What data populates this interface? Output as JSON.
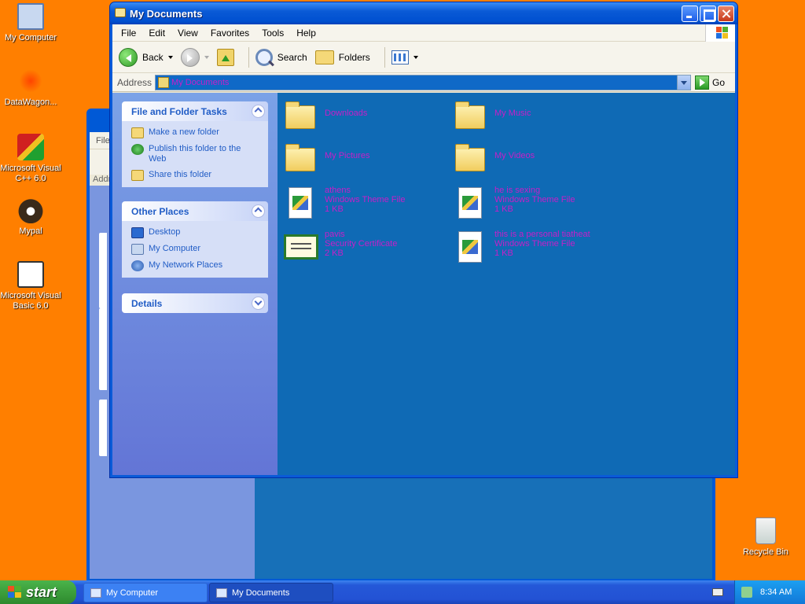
{
  "desktop": {
    "icons": [
      {
        "label": "My Computer"
      },
      {
        "label": "DataWagon..."
      },
      {
        "label": "Microsoft Visual C++ 6.0"
      },
      {
        "label": "Mypal"
      },
      {
        "label": "Microsoft Visual Basic 6.0"
      },
      {
        "label": "Recycle Bin"
      }
    ]
  },
  "background_window": {
    "menu_first": "File",
    "address_label": "Addr"
  },
  "window": {
    "title": "My Documents",
    "menu": [
      "File",
      "Edit",
      "View",
      "Favorites",
      "Tools",
      "Help"
    ],
    "toolbar": {
      "back": "Back",
      "search": "Search",
      "folders": "Folders"
    },
    "address": {
      "label": "Address",
      "value": "My Documents",
      "go": "Go"
    },
    "tasks_panel": {
      "title": "File and Folder Tasks",
      "items": [
        "Make a new folder",
        "Publish this folder to the Web",
        "Share this folder"
      ]
    },
    "places_panel": {
      "title": "Other Places",
      "items": [
        "Desktop",
        "My Computer",
        "My Network Places"
      ]
    },
    "details_panel": {
      "title": "Details"
    },
    "files": [
      {
        "name": "Downloads",
        "type": "",
        "size": ""
      },
      {
        "name": "My Music",
        "type": "",
        "size": ""
      },
      {
        "name": "My Pictures",
        "type": "",
        "size": ""
      },
      {
        "name": "My Videos",
        "type": "",
        "size": ""
      },
      {
        "name": "athens",
        "type": "Windows Theme File",
        "size": "1 KB"
      },
      {
        "name": "he is sexing",
        "type": "Windows Theme File",
        "size": "1 KB"
      },
      {
        "name": "pavis",
        "type": "Security Certificate",
        "size": "2 KB"
      },
      {
        "name": "this is a personal tiatheat",
        "type": "Windows Theme File",
        "size": "1 KB"
      }
    ]
  },
  "taskbar": {
    "start": "start",
    "buttons": [
      {
        "label": "My Computer",
        "active": false
      },
      {
        "label": "My Documents",
        "active": true
      }
    ],
    "clock": "8:34 AM"
  },
  "colors": {
    "desktop": "#ff7f00",
    "file_text": "#c81ec8",
    "file_pane": "#0f6ab5"
  }
}
